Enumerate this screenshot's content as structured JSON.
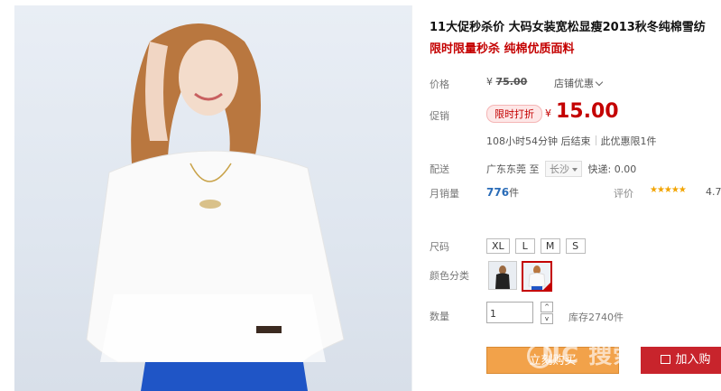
{
  "product": {
    "title": "11大促秒杀价 大码女装宽松显瘦2013秋冬纯棉雪纺",
    "subtitle": "限时限量秒杀 纯棉优质面料"
  },
  "price": {
    "label": "价格",
    "currency": "¥",
    "original": "75.00",
    "shop_discount": "店铺优惠"
  },
  "promotion": {
    "label": "促销",
    "tag": "限时打折",
    "currency": "¥",
    "price": "15.00",
    "countdown": "108小时54分钟 后结束",
    "limit": "此优惠限1件"
  },
  "shipping": {
    "label": "配送",
    "from": "广东东莞",
    "to_word": "至",
    "to_city": "长沙",
    "fee": "快递: 0.00"
  },
  "sales": {
    "label": "月销量",
    "count": "776",
    "unit": "件",
    "rating_label": "评价",
    "stars": "★★★★★",
    "rating_value": "4.7"
  },
  "size": {
    "label": "尺码",
    "options": [
      "XL",
      "L",
      "M",
      "S"
    ]
  },
  "color": {
    "label": "颜色分类",
    "selected_index": 1
  },
  "quantity": {
    "label": "数量",
    "value": "1",
    "up": "^",
    "down": "v",
    "stock": "库存2740件"
  },
  "actions": {
    "buy_now": "立刻购买",
    "add_to_cart": "加入购"
  },
  "watermark": "UC 搜索"
}
